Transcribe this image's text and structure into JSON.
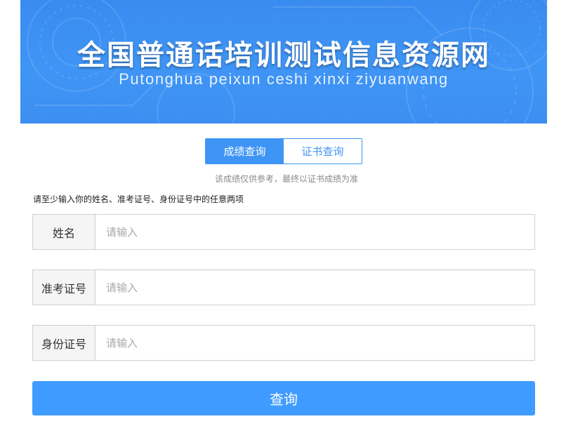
{
  "banner": {
    "title": "全国普通话培训测试信息资源网",
    "subtitle": "Putonghua peixun ceshi xinxi ziyuanwang"
  },
  "tabs": [
    {
      "label": "成绩查询",
      "active": true
    },
    {
      "label": "证书查询",
      "active": false
    }
  ],
  "note": "该成绩仅供参考，最终以证书成绩为准",
  "hint": "请至少输入你的姓名、准考证号、身份证号中的任意两项",
  "fields": [
    {
      "label": "姓名",
      "placeholder": "请输入"
    },
    {
      "label": "准考证号",
      "placeholder": "请输入"
    },
    {
      "label": "身份证号",
      "placeholder": "请输入"
    }
  ],
  "submit_label": "查询",
  "colors": {
    "accent": "#3f95f5",
    "button": "#3f9bff",
    "banner": "#3a8bf0"
  }
}
